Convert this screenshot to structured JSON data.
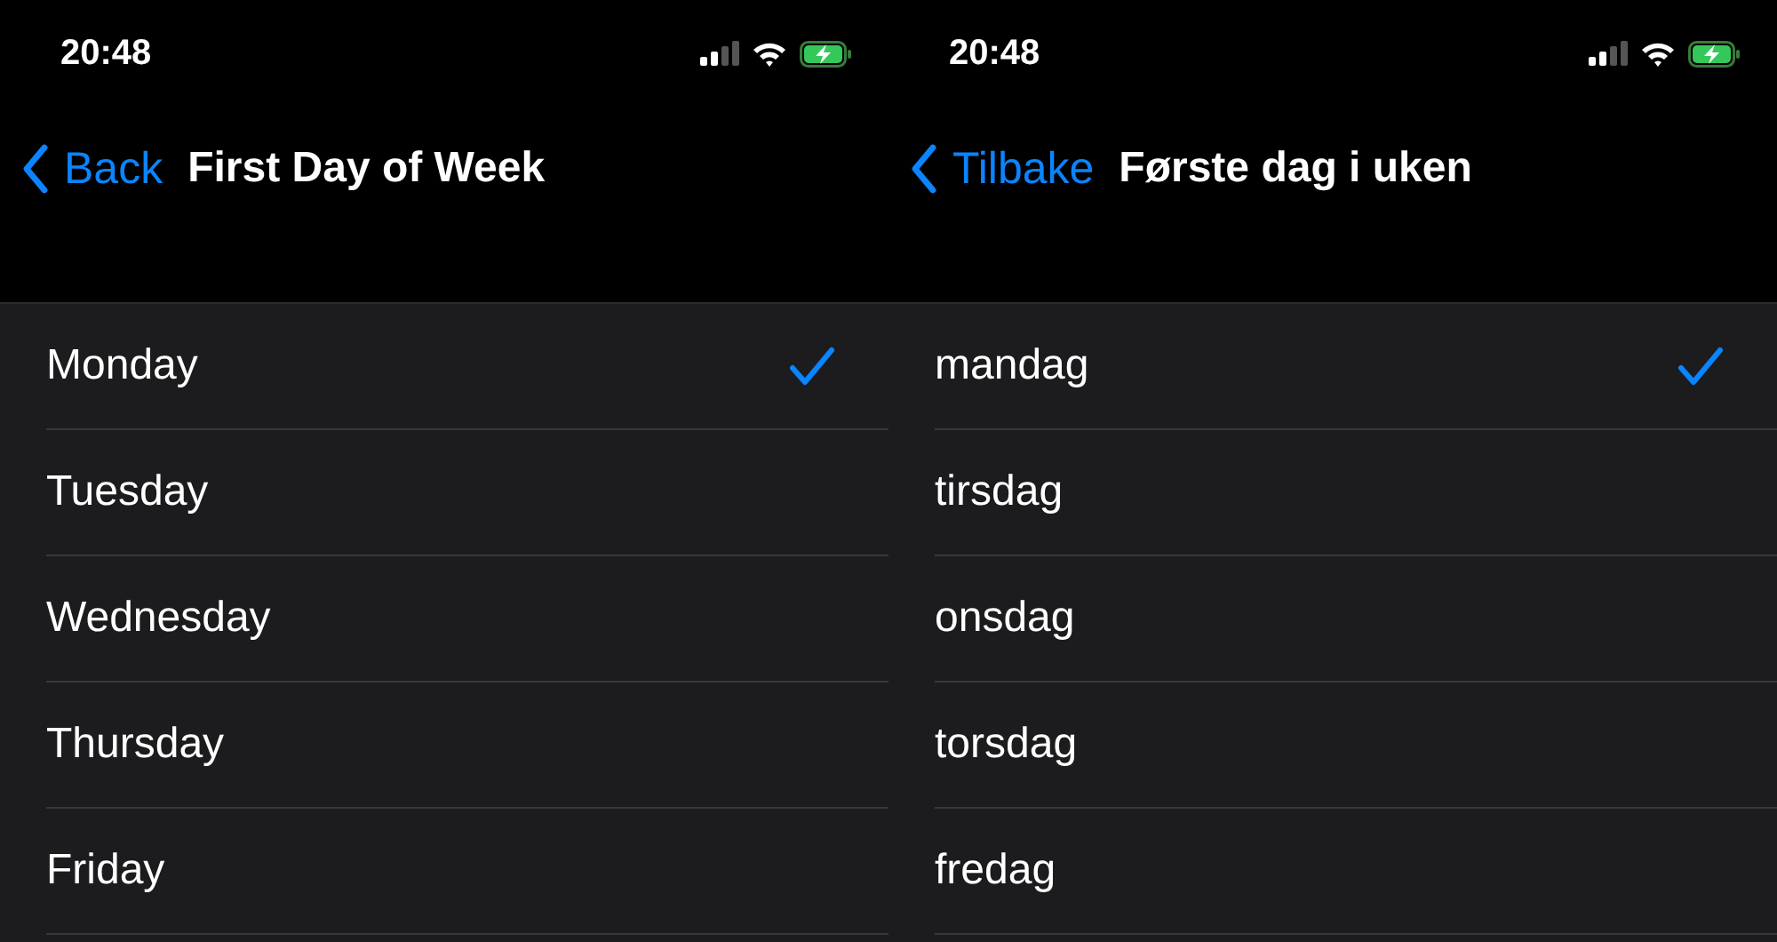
{
  "screens": [
    {
      "status_bar": {
        "time": "20:48"
      },
      "nav": {
        "back": "Back",
        "title": "First Day of Week"
      },
      "days": [
        {
          "label": "Monday",
          "selected": true
        },
        {
          "label": "Tuesday",
          "selected": false
        },
        {
          "label": "Wednesday",
          "selected": false
        },
        {
          "label": "Thursday",
          "selected": false
        },
        {
          "label": "Friday",
          "selected": false
        }
      ]
    },
    {
      "status_bar": {
        "time": "20:48"
      },
      "nav": {
        "back": "Tilbake",
        "title": "Første dag i uken"
      },
      "days": [
        {
          "label": "mandag",
          "selected": true
        },
        {
          "label": "tirsdag",
          "selected": false
        },
        {
          "label": "onsdag",
          "selected": false
        },
        {
          "label": "torsdag",
          "selected": false
        },
        {
          "label": "fredag",
          "selected": false
        }
      ]
    }
  ]
}
